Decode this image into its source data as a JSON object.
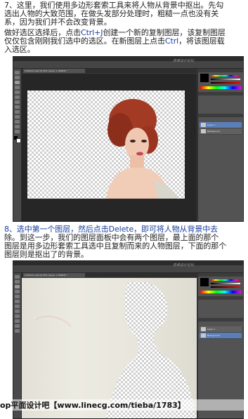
{
  "step7": {
    "line1": "7、这里，我们使用多边形套索工具来将人物从背景中抠出。先勾",
    "line2": "选出人物的大致范围，在做头发部分处理时，粗糙一点也没有关",
    "line3": "系，因为我们并不会改变背景。"
  },
  "step7b": {
    "line1a": "做好选区选择后，点击",
    "line1b": "Ctrl+J",
    "line1c": "创建一个新的复制图层，该复制图层",
    "line2a": "仅仅包含刚刚我们选中的选区。在新图层上点击",
    "line2b": "Ctrl",
    "line2c": "，将该图层载",
    "line3": "入选区。"
  },
  "step8": {
    "line1a": "8、选中第一个图层，然后点击",
    "line1b": "Delete",
    "line1c": "，即可将人物从背景中去",
    "line2": "除。到这一步，我们的图层面板中会有两个图层，最上面的那个",
    "line3": "图层是用多边形套索工具选中且复制而来的人物图层，下面的那个",
    "line4": "图层则是抠出了的背景。"
  },
  "screenshot1": {
    "watermark": "思缘设计论坛",
    "tab": "Untitled-1.psd @ 50% (Layer 1, RGB/8) *",
    "layers": [
      "Layer 1",
      "Background"
    ]
  },
  "screenshot2": {
    "watermark": "思缘设计论坛",
    "tab": "Untitled-1.psd @ 50% (Layer 1, RGB/8) *",
    "layers": [
      "Layer 1",
      "Background"
    ]
  },
  "footer": "op平面设计吧【www.linecg.com/tieba/1783】",
  "colors": {
    "accent_text": "#1a3fa0",
    "ps_bg": "#3a3a3a"
  }
}
